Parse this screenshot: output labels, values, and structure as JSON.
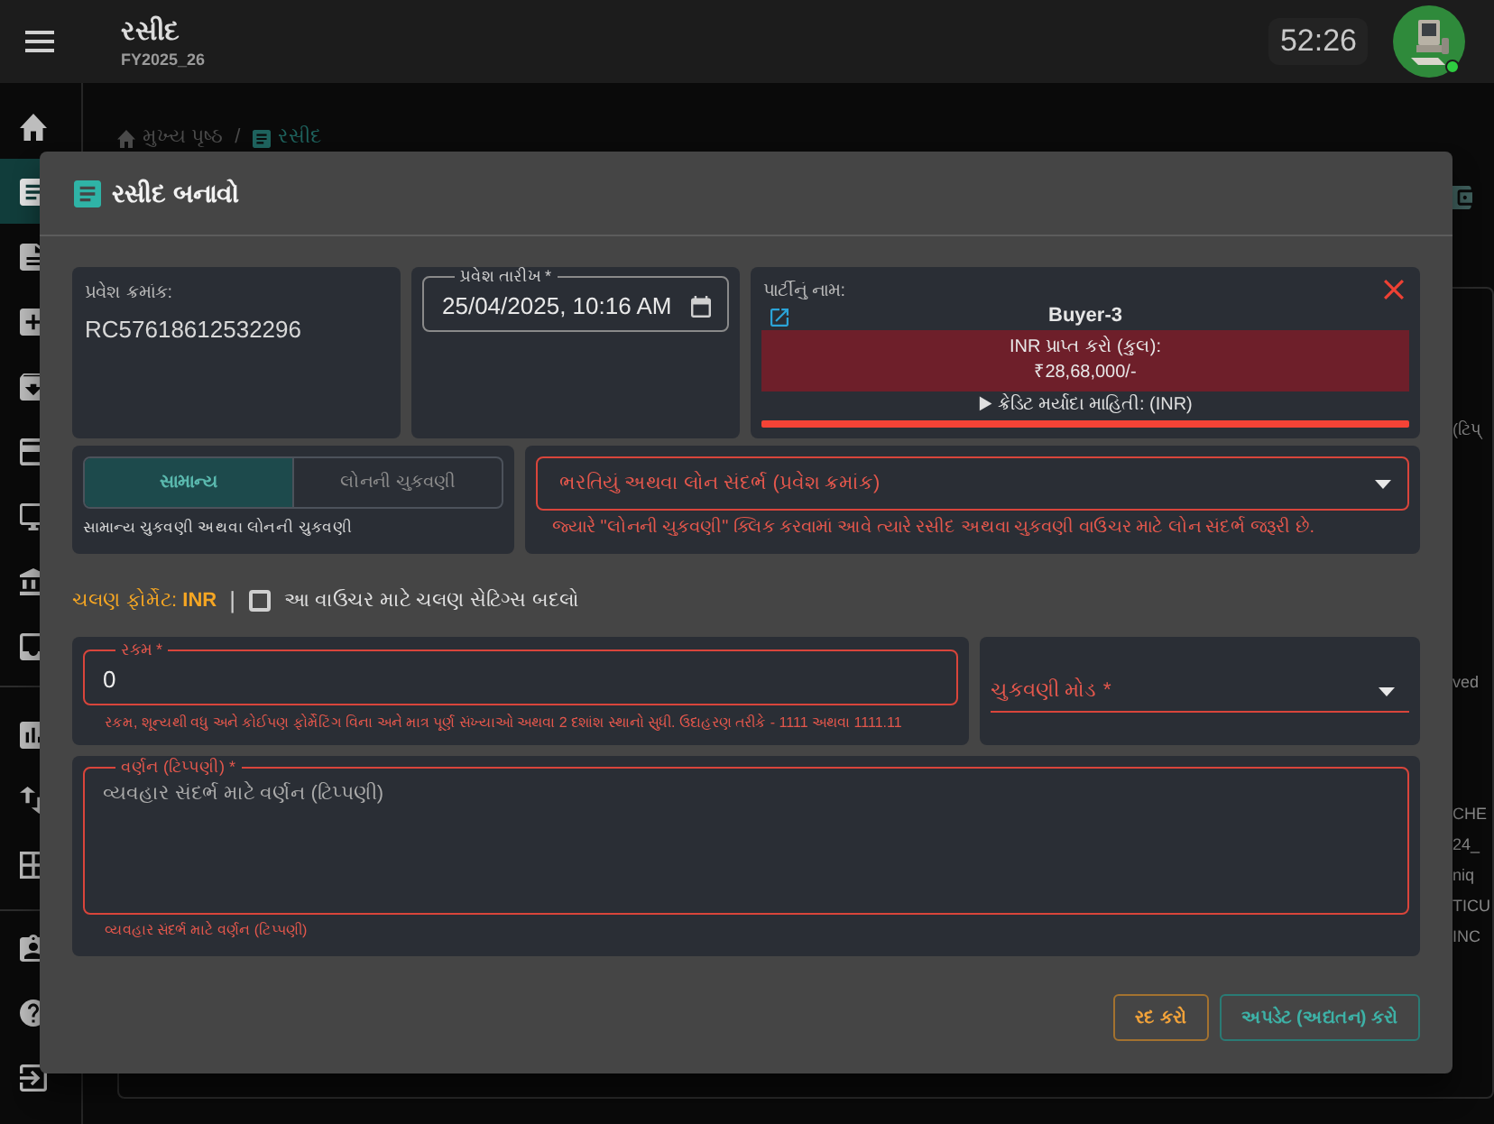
{
  "app_bar": {
    "title": "રસીદ",
    "subtitle": "FY2025_26",
    "timer": "52:26",
    "online": true
  },
  "sidebar": {
    "groups": [
      {
        "items": [
          {
            "selected": false
          },
          {
            "selected": true
          },
          {
            "selected": false
          },
          {
            "selected": false
          },
          {
            "selected": false
          },
          {
            "selected": false
          },
          {
            "selected": false
          },
          {
            "selected": false
          },
          {
            "selected": false
          }
        ]
      },
      {
        "items": [
          {
            "selected": false
          },
          {
            "selected": false
          },
          {
            "selected": false
          }
        ]
      },
      {
        "items": [
          {
            "selected": false
          },
          {
            "selected": false
          },
          {
            "selected": false
          }
        ]
      }
    ]
  },
  "breadcrumb": {
    "items": [
      {
        "label": "મુખ્ય પૃષ્ઠ",
        "current": false
      },
      {
        "label": "રસીદ",
        "current": true
      }
    ],
    "separator": "/"
  },
  "background_table": {
    "cell_fragments": [
      "(ટિપ્",
      "ved",
      "CHE",
      "24_",
      "niq",
      "TICU",
      "INC"
    ]
  },
  "dialog": {
    "title": "રસીદ બનાવો",
    "entry_number": {
      "label": "પ્રવેશ ક્રમાંક:",
      "value": "RC57618612532296"
    },
    "entry_date": {
      "label": "પ્રવેશ તારીખ *",
      "value": "25/04/2025, 10:16 AM",
      "error": false
    },
    "party": {
      "label": "પાર્ટીનું નામ:",
      "name": "Buyer-3",
      "balance_label": "INR પ્રાપ્ત કરો (કુલ):",
      "balance": "₹28,68,000/-",
      "credit_info": {
        "arrow": "▶",
        "label": "ક્રેડિટ મર્યાદા માહિતી: (INR)"
      },
      "credit_bar": {
        "level": 1
      }
    },
    "payment_type": {
      "options": [
        {
          "label": "સામાન્ય",
          "selected": true
        },
        {
          "label": "લોનની ચુકવણી",
          "selected": false
        }
      ],
      "helper": "સામાન્ય ચુકવણી અથવા લોનની ચુકવણી"
    },
    "reference": {
      "label": "ભરતિયું અથવા લોન સંદર્ભ (પ્રવેશ ક્રમાંક)",
      "error": true,
      "helper": "જ્યારે \"લોનની ચુકવણી\" ક્લિક કરવામાં આવે ત્યારે રસીદ અથવા ચુકવણી વાઉચર માટે લોન સંદર્ભ જરૂરી છે."
    },
    "currency": {
      "format": "ચલણ ફોર્મેટ: **INR**",
      "separator": "|",
      "override": {
        "label": "આ વાઉચર માટે ચલણ સેટિંગ્સ બદલો",
        "checked": false
      }
    },
    "amount": {
      "label": "રકમ *",
      "value": "0",
      "error": true,
      "helper": "રકમ, શૂન્યથી વધુ અને કોઈપણ ફોર્મેટિંગ વિના અને માત્ર પૂર્ણ સંખ્યાઓ અથવા 2 દશાંશ સ્થાનો સુધી. ઉદાહરણ તરીકે - 1111 અથવા 1111.11"
    },
    "payment_mode": {
      "label": "ચુકવણી મોડ *",
      "error": true
    },
    "description": {
      "label": "વર્ણન (ટિપ્પણી) *",
      "placeholder": "વ્યવહાર સંદર્ભ માટે વર્ણન (ટિપ્પણી)",
      "error": true,
      "helper": "વ્યવહાર સંદર્ભ માટે વર્ણન (ટિપ્પણી)"
    },
    "buttons": [
      {
        "label": "રદ કરો",
        "kind": "cancel"
      },
      {
        "label": "અપડેટ (અદ્યતન) કરો",
        "kind": "submit"
      }
    ]
  }
}
